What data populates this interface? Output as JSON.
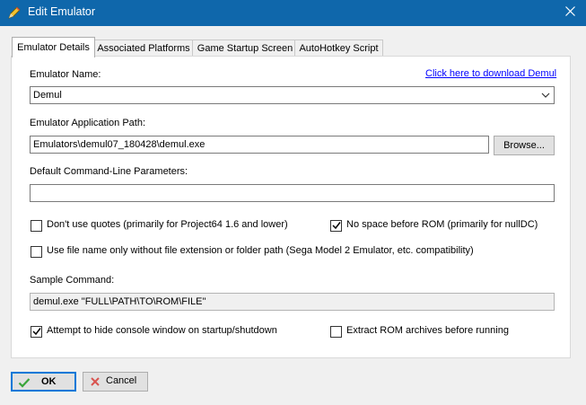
{
  "window": {
    "title": "Edit Emulator"
  },
  "tabs": [
    {
      "label": "Emulator Details"
    },
    {
      "label": "Associated Platforms"
    },
    {
      "label": "Game Startup Screen"
    },
    {
      "label": "AutoHotkey Script"
    }
  ],
  "details": {
    "emulator_name_label": "Emulator Name:",
    "download_link": "Click here to download Demul",
    "emulator_name_value": "Demul",
    "app_path_label": "Emulator Application Path:",
    "app_path_value": "Emulators\\demul07_180428\\demul.exe",
    "browse_label": "Browse...",
    "cmdline_label": "Default Command-Line Parameters:",
    "cmdline_value": "",
    "no_quotes": {
      "label": "Don't use quotes (primarily for Project64 1.6 and lower)",
      "checked": false
    },
    "no_space_before_rom": {
      "label": "No space before ROM (primarily for nullDC)",
      "checked": true
    },
    "filename_only": {
      "label": "Use file name only without file extension or folder path (Sega Model 2 Emulator, etc. compatibility)",
      "checked": false
    },
    "sample_command_label": "Sample Command:",
    "sample_command_value": "demul.exe \"FULL\\PATH\\TO\\ROM\\FILE\"",
    "hide_console": {
      "label": "Attempt to hide console window on startup/shutdown",
      "checked": true
    },
    "extract_rom": {
      "label": "Extract ROM archives before running",
      "checked": false
    }
  },
  "buttons": {
    "ok": "OK",
    "cancel": "Cancel"
  }
}
